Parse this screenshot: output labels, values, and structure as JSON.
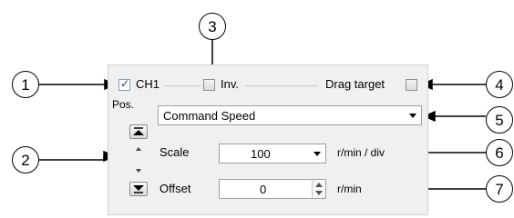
{
  "channel": {
    "ch1_label": "CH1",
    "ch1_checked": true,
    "inv_label": "Inv.",
    "inv_checked": false,
    "drag_target_label": "Drag target",
    "drag_target_checked": false
  },
  "position": {
    "label": "Pos."
  },
  "signal_select": {
    "value": "Command Speed"
  },
  "scale": {
    "label": "Scale",
    "value": "100",
    "unit": "r/min / div"
  },
  "offset": {
    "label": "Offset",
    "value": "0",
    "unit": "r/min"
  },
  "callouts": [
    "1",
    "2",
    "3",
    "4",
    "5",
    "6",
    "7"
  ]
}
